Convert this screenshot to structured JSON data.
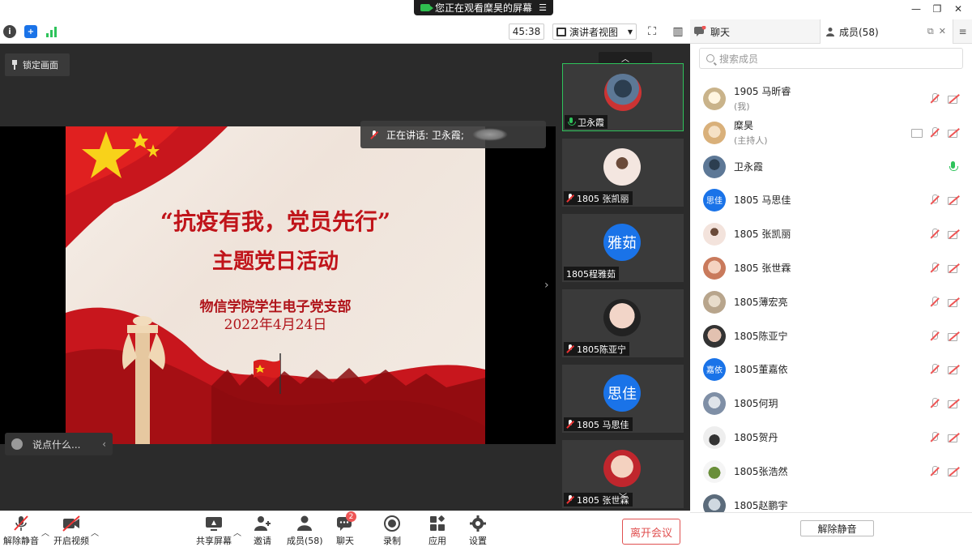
{
  "topbar": {
    "share_notice": "您正在观看糜昊的屏幕",
    "menu_glyph": "☰"
  },
  "toolbar": {
    "timer": "45:38",
    "view_mode": "演讲者视图"
  },
  "right_tabs": {
    "chat": "聊天",
    "members": "成员(58)"
  },
  "main": {
    "lock_label": "锁定画面",
    "speaking": "正在讲话: 卫永霞;",
    "chat_placeholder": "说点什么...",
    "slide": {
      "title_line1": "“抗疫有我，党员先行”",
      "title_line2": "主题党日活动",
      "org": "物信学院学生电子党支部",
      "date": "2022年4月24日"
    }
  },
  "tiles": [
    {
      "name": "卫永霞",
      "mic": "on",
      "active": true,
      "avatar_text": "",
      "avatar_color": "#c33"
    },
    {
      "name": "1805 张凯丽",
      "mic": "off",
      "active": false,
      "avatar_text": "",
      "avatar_color": "#f4e6e0"
    },
    {
      "name": "1805程雅茹",
      "mic": "none",
      "active": false,
      "avatar_text": "雅茹",
      "avatar_color": "#1a73e8"
    },
    {
      "name": "1805陈亚宁",
      "mic": "off",
      "active": false,
      "avatar_text": "",
      "avatar_color": "#f2d5c8"
    },
    {
      "name": "1805 马思佳",
      "mic": "off",
      "active": false,
      "avatar_text": "思佳",
      "avatar_color": "#1a73e8"
    },
    {
      "name": "1805 张世霖",
      "mic": "off",
      "active": false,
      "avatar_text": "",
      "avatar_color": "#e8b7a0"
    }
  ],
  "members": {
    "search_placeholder": "搜索成员",
    "unmute_all": "解除静音",
    "list": [
      {
        "name": "1905 马昕睿",
        "sub": "(我)",
        "avatar_text": "",
        "avatar_color": "#c9b38a"
      },
      {
        "name": "糜昊",
        "sub": "(主持人)",
        "avatar_text": "",
        "avatar_color": "#d9b07a"
      },
      {
        "name": "卫永霞",
        "sub": "",
        "avatar_text": "",
        "avatar_color": "#34495e"
      },
      {
        "name": "1805 马思佳",
        "sub": "",
        "avatar_text": "思佳",
        "avatar_color": "#1a73e8"
      },
      {
        "name": "1805 张凯丽",
        "sub": "",
        "avatar_text": "",
        "avatar_color": "#f3e3dc"
      },
      {
        "name": "1805 张世霖",
        "sub": "",
        "avatar_text": "",
        "avatar_color": "#c97a5c"
      },
      {
        "name": "1805薄宏亮",
        "sub": "",
        "avatar_text": "",
        "avatar_color": "#b8a58c"
      },
      {
        "name": "1805陈亚宁",
        "sub": "",
        "avatar_text": "",
        "avatar_color": "#e2c1b0"
      },
      {
        "name": "1805董嘉依",
        "sub": "",
        "avatar_text": "嘉依",
        "avatar_color": "#1a73e8"
      },
      {
        "name": "1805何玥",
        "sub": "",
        "avatar_text": "",
        "avatar_color": "#7f8fa6"
      },
      {
        "name": "1805贺丹",
        "sub": "",
        "avatar_text": "",
        "avatar_color": "#333"
      },
      {
        "name": "1805张浩然",
        "sub": "",
        "avatar_text": "",
        "avatar_color": "#6a8f3a"
      },
      {
        "name": "1805赵鹏宇",
        "sub": "",
        "avatar_text": "",
        "avatar_color": "#5b6b7b"
      }
    ]
  },
  "bottombar": {
    "unmute": "解除静音",
    "start_video": "开启视频",
    "share_screen": "共享屏幕",
    "invite": "邀请",
    "members": "成员(58)",
    "chat": "聊天",
    "chat_badge": "2",
    "record": "录制",
    "apps": "应用",
    "settings": "设置",
    "leave": "离开会议"
  },
  "colors": {
    "accent": "#1a73e8",
    "mic_on": "#2ec35b",
    "danger": "#e05050"
  }
}
